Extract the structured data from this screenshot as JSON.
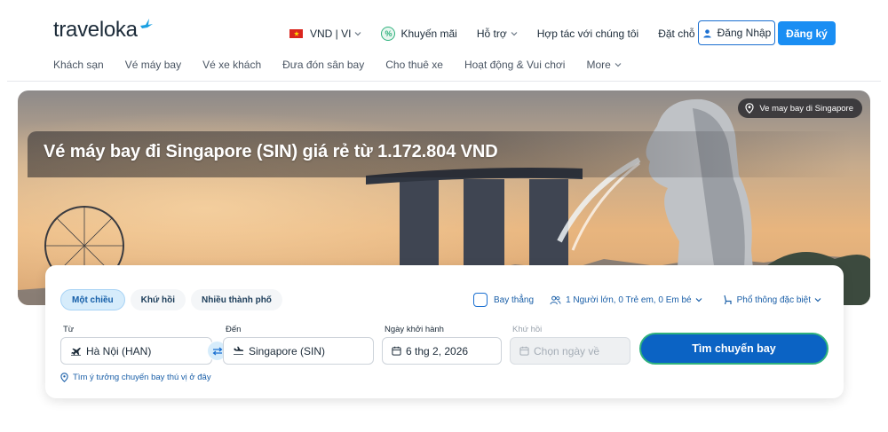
{
  "brand": {
    "name": "traveloka"
  },
  "topnav": {
    "currency": "VND | VI",
    "promo": "Khuyến mãi",
    "support": "Hỗ trợ",
    "partner": "Hợp tác với chúng tôi",
    "bookings": "Đặt chỗ của tôi",
    "login": "Đăng Nhập",
    "register": "Đăng ký"
  },
  "subnav": {
    "items": [
      "Khách sạn",
      "Vé máy bay",
      "Vé xe khách",
      "Đưa đón sân bay",
      "Cho thuê xe",
      "Hoạt động & Vui chơi",
      "More"
    ]
  },
  "hero": {
    "location_tag": "Ve may bay di Singapore",
    "title": "Vé máy bay đi Singapore (SIN) giá rẻ từ 1.172.804 VND"
  },
  "search": {
    "tabs": [
      "Một chiều",
      "Khứ hồi",
      "Nhiều thành phố"
    ],
    "active_tab": "Một chiều",
    "direct_label": "Bay thẳng",
    "passengers": "1 Người lớn, 0 Trẻ em, 0 Em bé",
    "cabin": "Phổ thông đặc biệt",
    "from_label": "Từ",
    "from_value": "Hà Nội (HAN)",
    "to_label": "Đến",
    "to_value": "Singapore (SIN)",
    "depart_label": "Ngày khởi hành",
    "depart_value": "6 thg 2, 2026",
    "return_label": "Khứ hồi",
    "return_placeholder": "Chọn ngày về",
    "search_button": "Tìm chuyến bay",
    "hint": "Tìm ý tưởng chuyến bay thú vị ở đây"
  },
  "colors": {
    "primary": "#1a8ef3",
    "button_dark": "#0b63c4",
    "accent_green": "#2fb27d",
    "flag_red": "#da251d"
  }
}
